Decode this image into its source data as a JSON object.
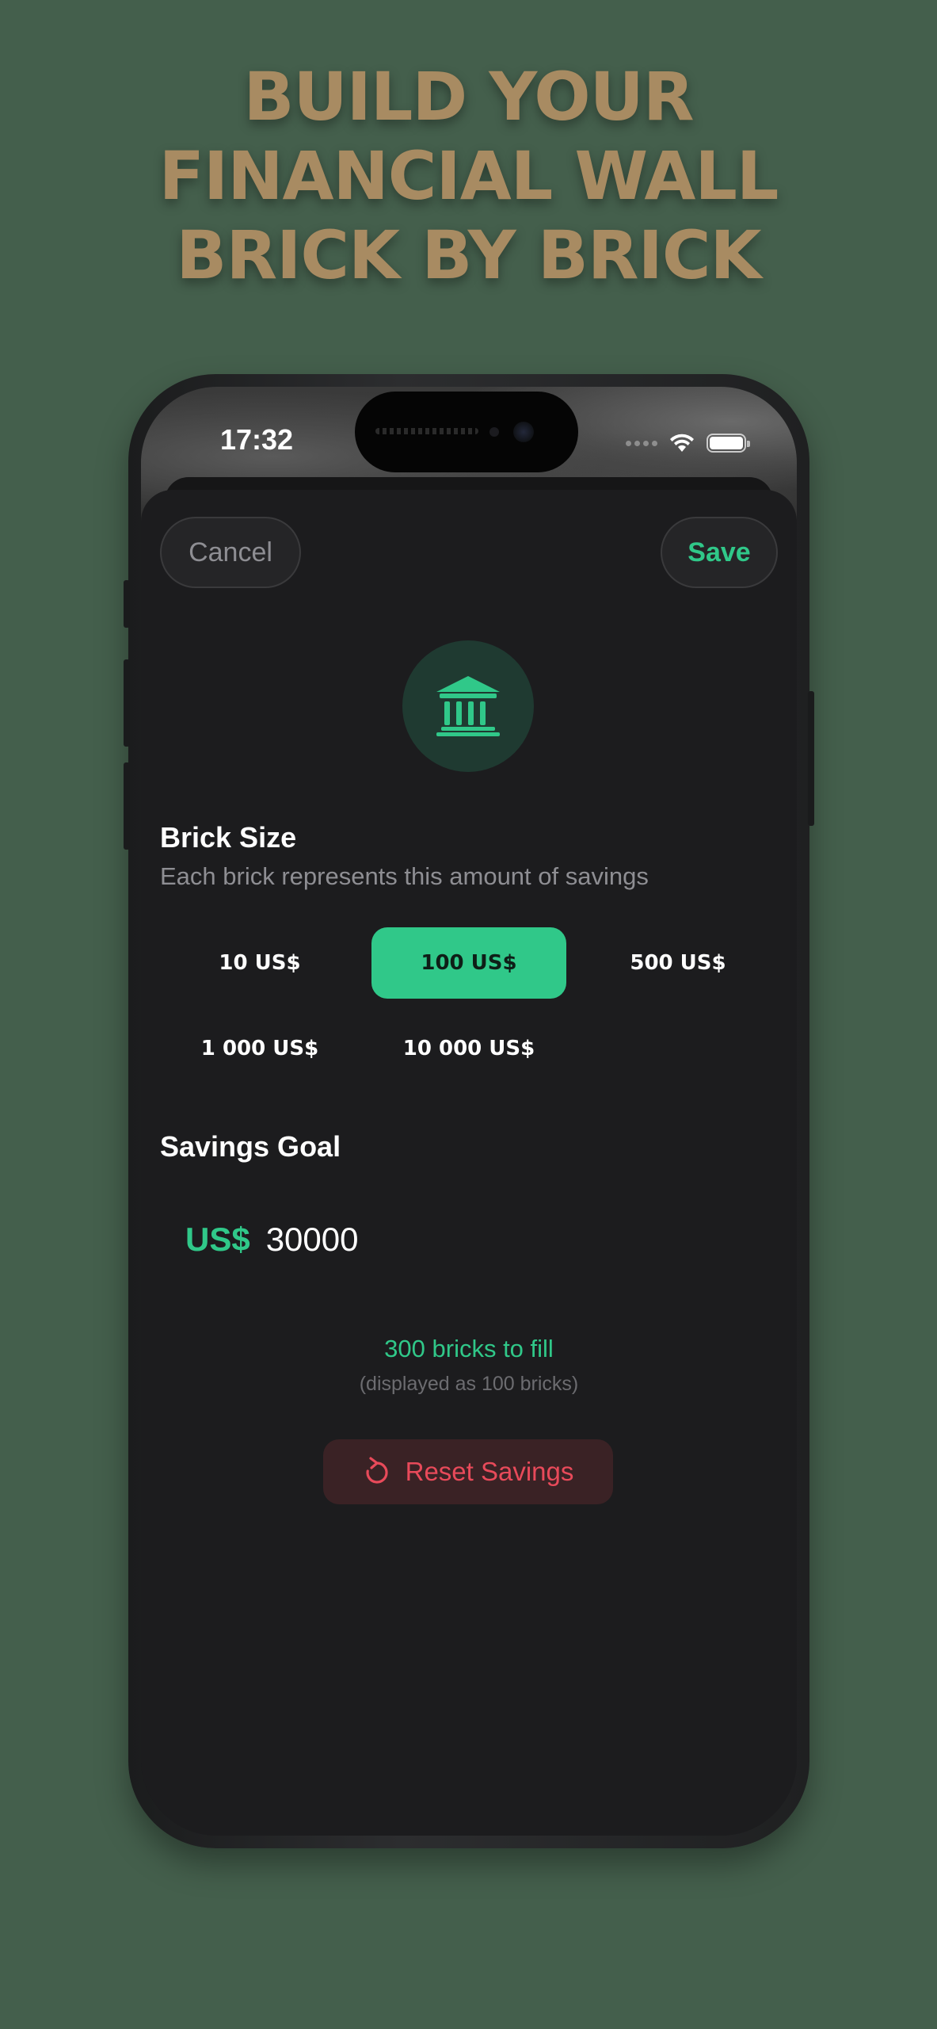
{
  "headline": {
    "line1": "BUILD YOUR",
    "line2": "FINANCIAL WALL",
    "line3": "BRICK BY BRICK"
  },
  "status_bar": {
    "time": "17:32",
    "icons": [
      "cellular-icon",
      "wifi-icon",
      "battery-icon"
    ]
  },
  "nav": {
    "cancel_label": "Cancel",
    "save_label": "Save"
  },
  "header_icon": "bank-icon",
  "brick_size": {
    "title": "Brick Size",
    "subtitle": "Each brick represents this amount of savings",
    "options": [
      "10 US$",
      "100 US$",
      "500 US$",
      "1 000 US$",
      "10 000 US$"
    ],
    "selected": "100 US$"
  },
  "savings_goal": {
    "title": "Savings Goal",
    "currency": "US$",
    "value": "30000"
  },
  "summary": {
    "bricks_to_fill": "300 bricks to fill",
    "displayed_note": "(displayed as 100 bricks)"
  },
  "reset": {
    "label": "Reset Savings",
    "icon": "reset-icon"
  },
  "colors": {
    "background": "#445f4c",
    "headline": "#a88b62",
    "accent_green": "#30c889",
    "danger_red": "#e84a5a",
    "sheet": "#1c1c1e"
  }
}
